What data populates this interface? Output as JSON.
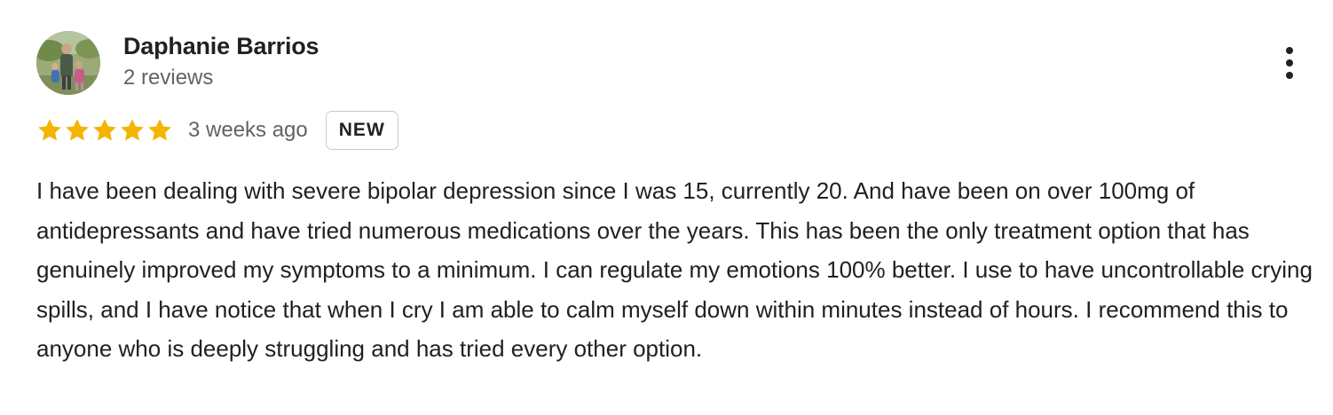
{
  "review": {
    "reviewer": {
      "name": "Daphanie Barrios",
      "review_count": "2 reviews",
      "avatar": "avatar-photo"
    },
    "rating": {
      "stars": 5,
      "max_stars": 5,
      "star_color": "#f4b400"
    },
    "time_ago": "3 weeks ago",
    "badge": "NEW",
    "text": "I have been dealing with severe bipolar depression since I was 15, currently 20. And have been on over 100mg of antidepressants and have tried numerous medications over the years. This has been the only treatment option that has genuinely improved my symptoms to a minimum. I can regulate my emotions 100% better. I use to have uncontrollable crying spills, and I have notice that when I cry I am able to calm myself down within minutes instead of hours. I recommend this to anyone who is deeply struggling and has tried every other option.",
    "menu_icon": "more-vertical-icon"
  }
}
